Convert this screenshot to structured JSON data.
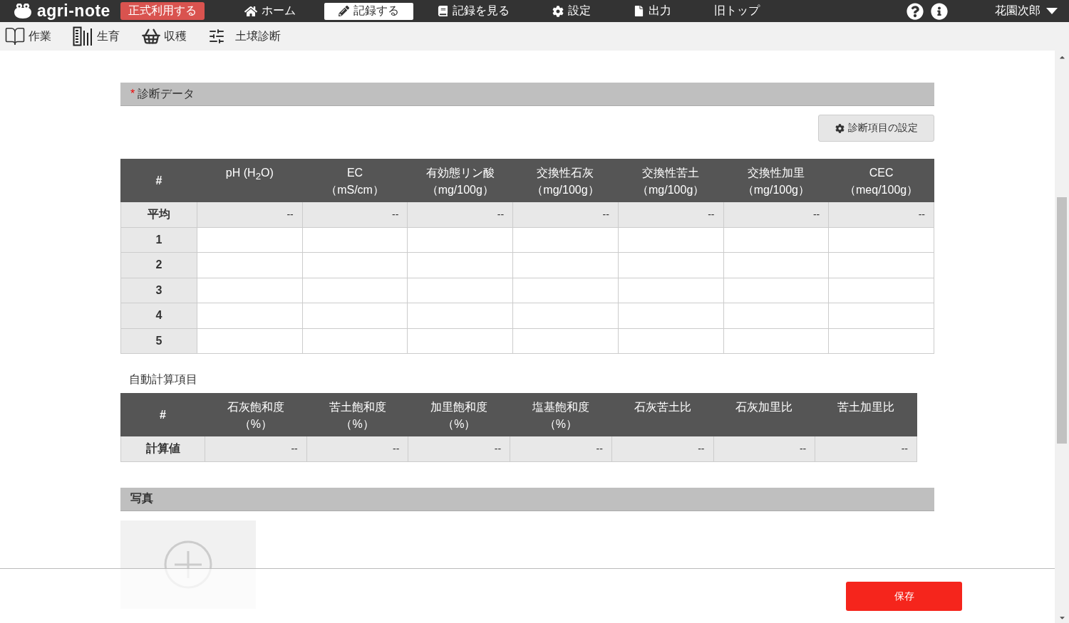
{
  "header": {
    "logo": "agri-note",
    "cta": "正式利用する",
    "nav": [
      {
        "label": "ホーム",
        "kind": "home",
        "selected": false
      },
      {
        "label": "記録する",
        "kind": "pencil",
        "selected": true
      },
      {
        "label": "記録を見る",
        "kind": "book",
        "selected": false
      },
      {
        "label": "設定",
        "kind": "gear",
        "selected": false
      },
      {
        "label": "出力",
        "kind": "file",
        "selected": false
      },
      {
        "label": "旧トップ",
        "kind": "text",
        "selected": false
      }
    ],
    "user": "花園次郎"
  },
  "subnav": [
    {
      "label": "作業",
      "kind": "book-open"
    },
    {
      "label": "生育",
      "kind": "growth"
    },
    {
      "label": "収穫",
      "kind": "basket"
    },
    {
      "label": "土壌診断",
      "kind": "sliders"
    }
  ],
  "diagnosis": {
    "required_mark": "*",
    "title": "診断データ",
    "settings_button": "診断項目の設定",
    "corner_label": "#",
    "columns": [
      {
        "label": "pH (H$_{2}$O)"
      },
      {
        "label": "EC",
        "unit": "（mS/cm）"
      },
      {
        "label": "有効態リン酸",
        "unit": "（mg/100g）"
      },
      {
        "label": "交換性石灰",
        "unit": "（mg/100g）"
      },
      {
        "label": "交換性苦土",
        "unit": "（mg/100g）"
      },
      {
        "label": "交換性加里",
        "unit": "（mg/100g）"
      },
      {
        "label": "CEC",
        "unit": "（meq/100g）"
      }
    ],
    "rows": [
      {
        "label": "平均",
        "cells": [
          "--",
          "--",
          "--",
          "--",
          "--",
          "--",
          "--"
        ]
      },
      {
        "label": "1"
      },
      {
        "label": "2"
      },
      {
        "label": "3"
      },
      {
        "label": "4"
      },
      {
        "label": "5"
      }
    ]
  },
  "auto_calc": {
    "title": "自動計算項目",
    "corner_label": "#",
    "columns": [
      {
        "label": "石灰飽和度",
        "unit": "（%）"
      },
      {
        "label": "苦土飽和度",
        "unit": "（%）"
      },
      {
        "label": "加里飽和度",
        "unit": "（%）"
      },
      {
        "label": "塩基飽和度",
        "unit": "（%）"
      },
      {
        "label": "石灰苦土比"
      },
      {
        "label": "石灰加里比"
      },
      {
        "label": "苦土加里比"
      }
    ],
    "rows": [
      {
        "label": "計算値",
        "cells": [
          "--",
          "--",
          "--",
          "--",
          "--",
          "--",
          "--"
        ]
      }
    ]
  },
  "photo": {
    "title": "写真"
  },
  "footer": {
    "save_button": "保存"
  }
}
